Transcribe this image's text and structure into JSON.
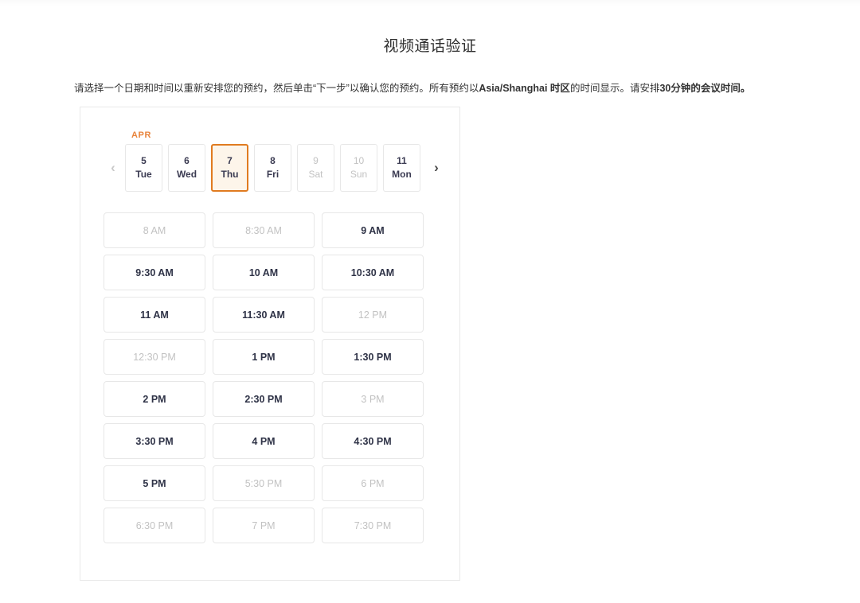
{
  "page": {
    "title": "视频通话验证"
  },
  "description": {
    "part1": "请选择一个日期和时间以重新安排您的预约，然后单击“下一步”以确认您的预约。所有预约以",
    "bold1": "Asia/Shanghai 时区",
    "part2": "的时间显示。请安排",
    "bold2": "30分钟的会议时间。"
  },
  "date_picker": {
    "month_label": "APR",
    "prev_icon": "chevron-left-icon",
    "next_icon": "chevron-right-icon",
    "prev_label": "‹",
    "next_label": "›",
    "days": [
      {
        "num": "5",
        "name": "Tue",
        "state": "available"
      },
      {
        "num": "6",
        "name": "Wed",
        "state": "available"
      },
      {
        "num": "7",
        "name": "Thu",
        "state": "selected"
      },
      {
        "num": "8",
        "name": "Fri",
        "state": "available"
      },
      {
        "num": "9",
        "name": "Sat",
        "state": "disabled"
      },
      {
        "num": "10",
        "name": "Sun",
        "state": "disabled"
      },
      {
        "num": "11",
        "name": "Mon",
        "state": "available"
      }
    ]
  },
  "time_slots": [
    {
      "label": "8 AM",
      "state": "disabled"
    },
    {
      "label": "8:30 AM",
      "state": "disabled"
    },
    {
      "label": "9 AM",
      "state": "available"
    },
    {
      "label": "9:30 AM",
      "state": "available"
    },
    {
      "label": "10 AM",
      "state": "available"
    },
    {
      "label": "10:30 AM",
      "state": "available"
    },
    {
      "label": "11 AM",
      "state": "available"
    },
    {
      "label": "11:30 AM",
      "state": "available"
    },
    {
      "label": "12 PM",
      "state": "disabled"
    },
    {
      "label": "12:30 PM",
      "state": "disabled"
    },
    {
      "label": "1 PM",
      "state": "available"
    },
    {
      "label": "1:30 PM",
      "state": "available"
    },
    {
      "label": "2 PM",
      "state": "available"
    },
    {
      "label": "2:30 PM",
      "state": "available"
    },
    {
      "label": "3 PM",
      "state": "disabled"
    },
    {
      "label": "3:30 PM",
      "state": "available"
    },
    {
      "label": "4 PM",
      "state": "available"
    },
    {
      "label": "4:30 PM",
      "state": "available"
    },
    {
      "label": "5 PM",
      "state": "available"
    },
    {
      "label": "5:30 PM",
      "state": "disabled"
    },
    {
      "label": "6 PM",
      "state": "disabled"
    },
    {
      "label": "6:30 PM",
      "state": "disabled"
    },
    {
      "label": "7 PM",
      "state": "disabled"
    },
    {
      "label": "7:30 PM",
      "state": "disabled"
    }
  ],
  "colors": {
    "accent": "#e07b20",
    "accent_light": "#fdf5ea",
    "month_text": "#e8843c",
    "border": "#e7e7e7",
    "text": "#2f3347",
    "text_disabled": "#c2c2c2"
  }
}
